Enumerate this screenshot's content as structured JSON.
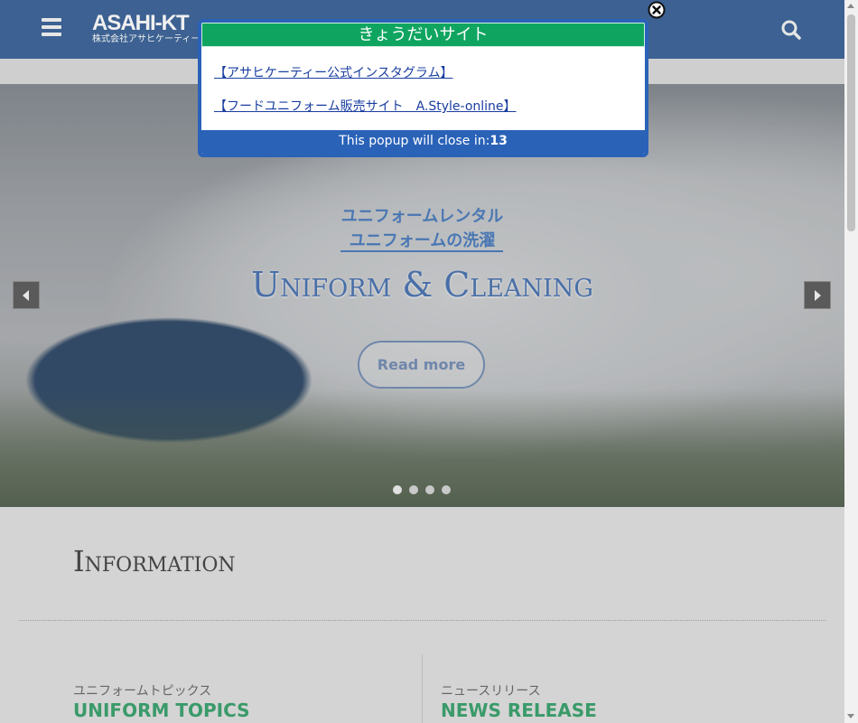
{
  "header": {
    "logo_mark": "ASAHI-KT",
    "logo_sub": "株式会社アサヒケーティー"
  },
  "hero": {
    "jp_line1": "ユニフォームレンタル",
    "jp_line2": "ユニフォームの洗濯",
    "title": "Uniform & Cleaning",
    "read_more": "Read more",
    "slide_count": 4,
    "active_slide": 1
  },
  "information": {
    "title": "Information",
    "columns": [
      {
        "jp": "ユニフォームトピックス",
        "en": "UNIFORM TOPICS"
      },
      {
        "jp": "ニュースリリース",
        "en": "NEWS RELEASE"
      }
    ]
  },
  "popup": {
    "title": "きょうだいサイト",
    "links": [
      "【アサヒケーティー公式インスタグラム】",
      "【フードユニフォーム販売サイト　A.Style-online】"
    ],
    "countdown_label": "This popup will close in:",
    "countdown_value": "13"
  },
  "colors": {
    "header": "#4a77b3",
    "popup_header": "#0fa560",
    "popup_border": "#2a62b8",
    "topic_green": "#3a9a6a"
  }
}
